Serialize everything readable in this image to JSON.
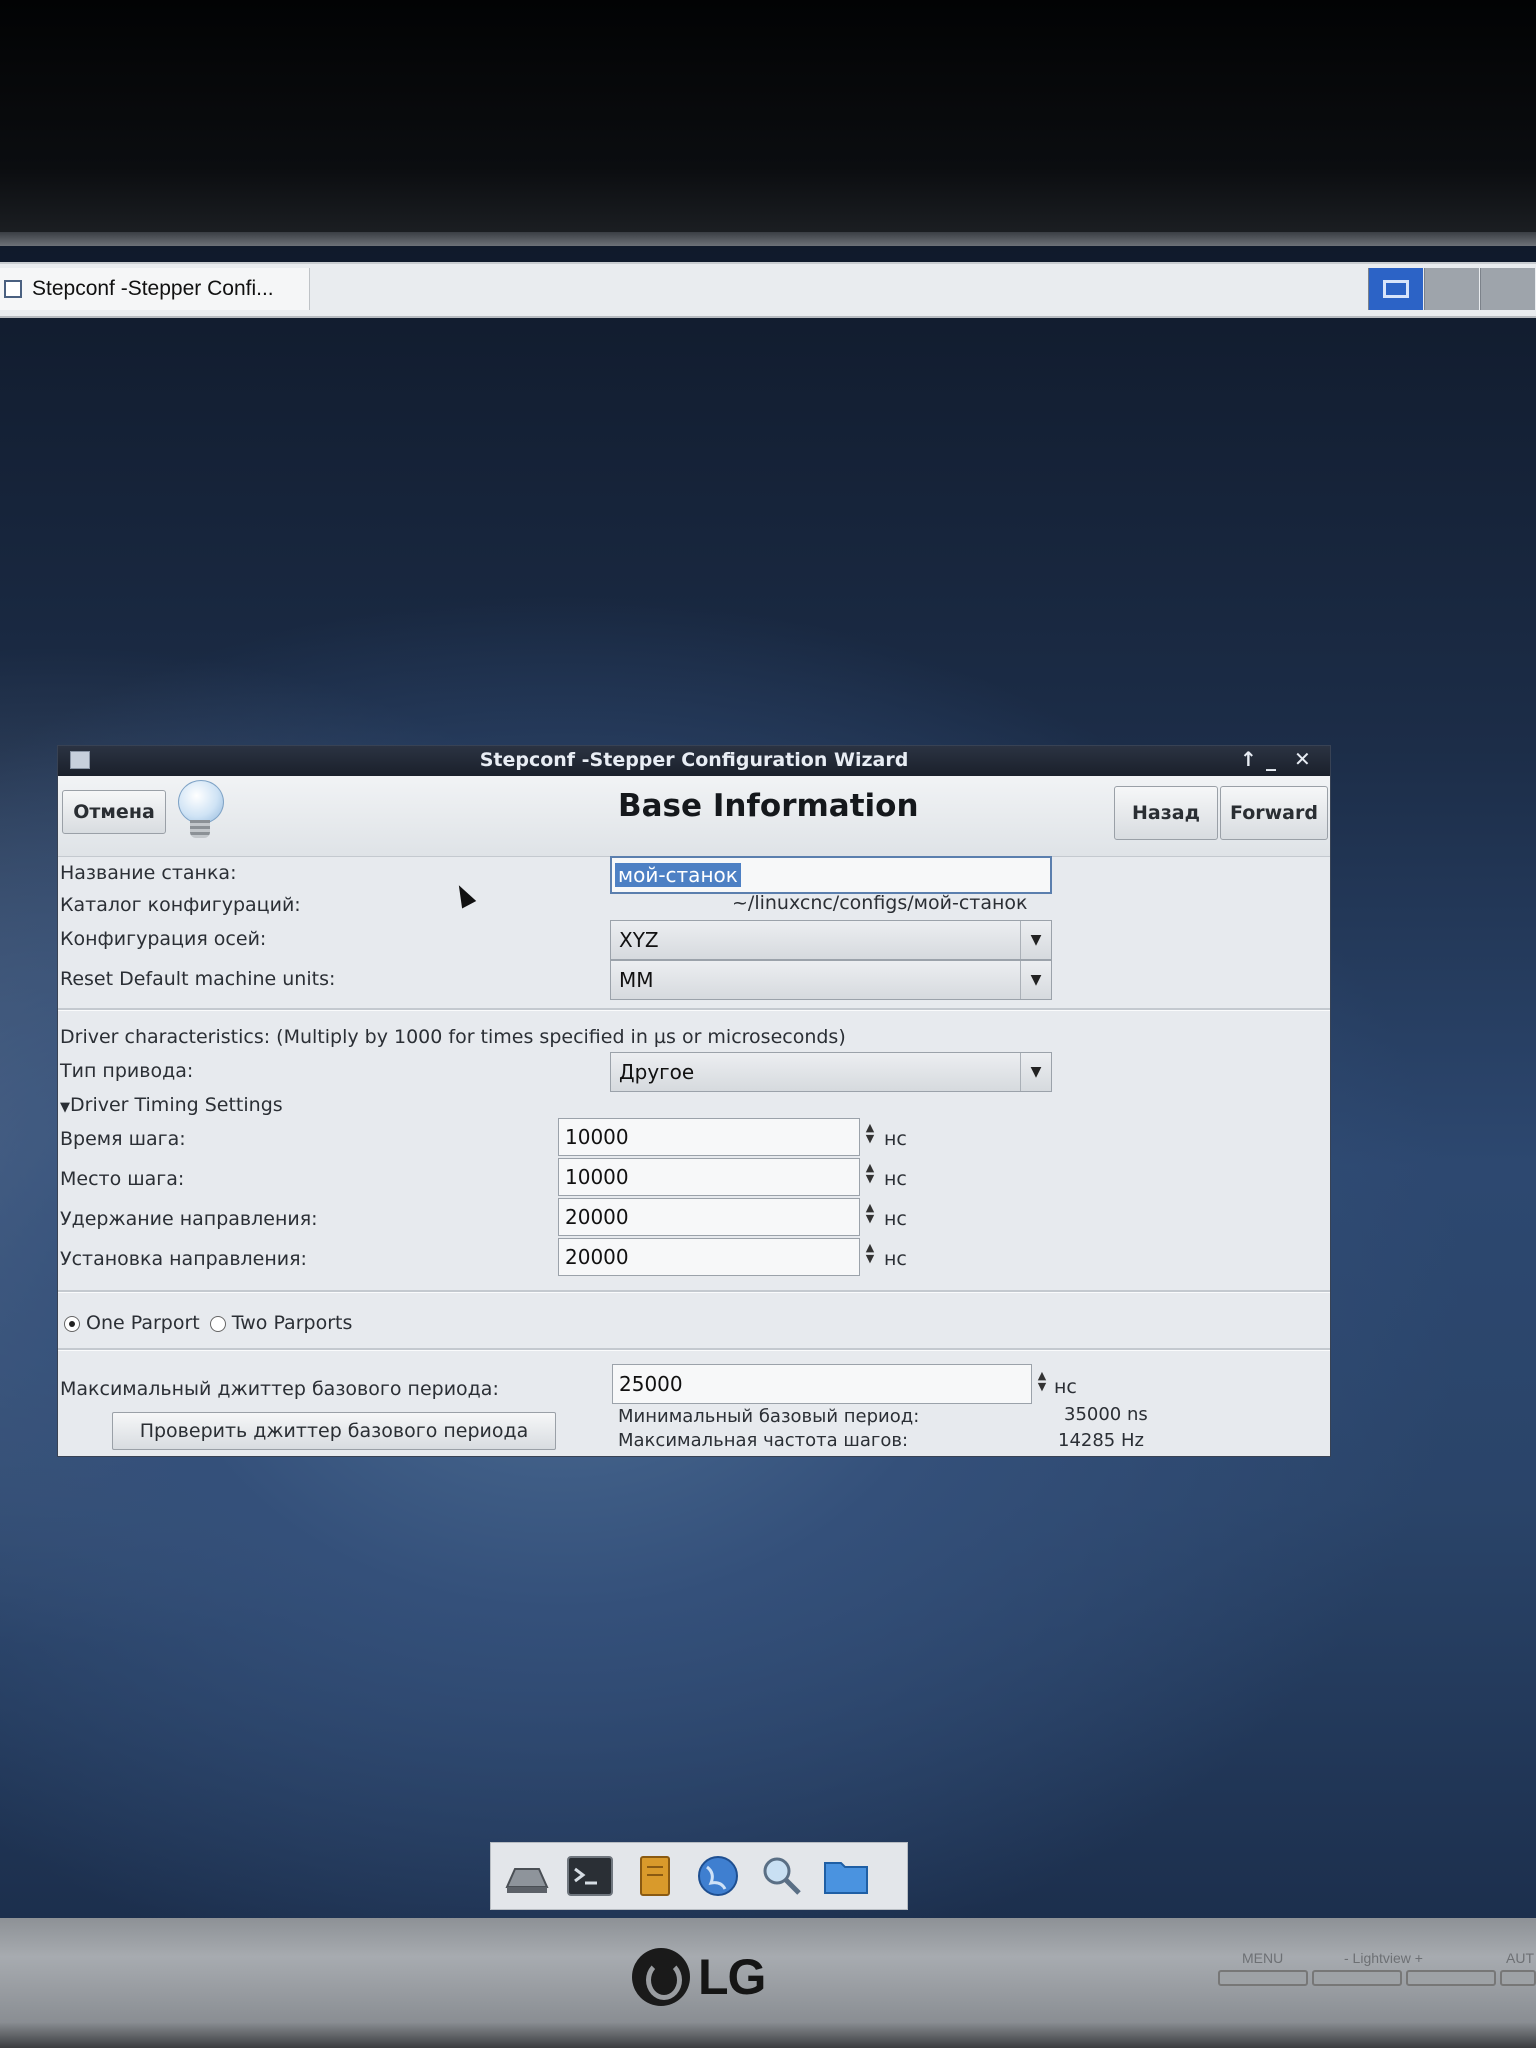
{
  "taskbar": {
    "window_button_label": "Stepconf -Stepper Confi..."
  },
  "window": {
    "title": "Stepconf -Stepper Configuration Wizard",
    "controls": {
      "maximize": "↑",
      "minimize": "_",
      "close": "✕"
    }
  },
  "header": {
    "cancel_label": "Отмена",
    "page_title": "Base Information",
    "back_label": "Назад",
    "forward_label": "Forward"
  },
  "base": {
    "machine_name_label": "Название станка:",
    "machine_name_value": "мой-станок",
    "config_dir_label": "Каталог конфигураций:",
    "config_dir_value": "~/linuxcnc/configs/мой-станок",
    "axis_config_label": "Конфигурация осей:",
    "axis_config_value": "XYZ",
    "units_label": "Reset Default machine units:",
    "units_value": "MM"
  },
  "driver": {
    "characteristics_label": "Driver characteristics: (Multiply by 1000 for times specified in µs or microseconds)",
    "type_label": "Тип привода:",
    "type_value": "Другое",
    "timing_expander_label": "Driver Timing Settings",
    "step_time_label": "Время шага:",
    "step_time_value": "10000",
    "step_space_label": "Место шага:",
    "step_space_value": "10000",
    "dir_hold_label": "Удержание направления:",
    "dir_hold_value": "20000",
    "dir_setup_label": "Установка направления:",
    "dir_setup_value": "20000",
    "unit_label": "нс"
  },
  "parport": {
    "one_label": "One Parport",
    "two_label": "Two Parports",
    "selected": "One Parport"
  },
  "jitter": {
    "max_jitter_label": "Максимальный джиттер базового периода:",
    "max_jitter_value": "25000",
    "unit_label": "нс",
    "test_button_label": "Проверить джиттер базового периода",
    "min_period_label": "Минимальный базовый период:",
    "min_period_value": "35000 ns",
    "max_step_rate_label": "Максимальная частота шагов:",
    "max_step_rate_value": "14285 Hz"
  },
  "monitor": {
    "brand": "LG",
    "menu_label": "MENU",
    "lightview_label": "- Lightview +",
    "auto_label": "AUT"
  },
  "dock": {
    "items": [
      "drive-icon",
      "terminal-icon",
      "text-editor-icon",
      "web-browser-icon",
      "search-icon",
      "folder-icon"
    ]
  }
}
